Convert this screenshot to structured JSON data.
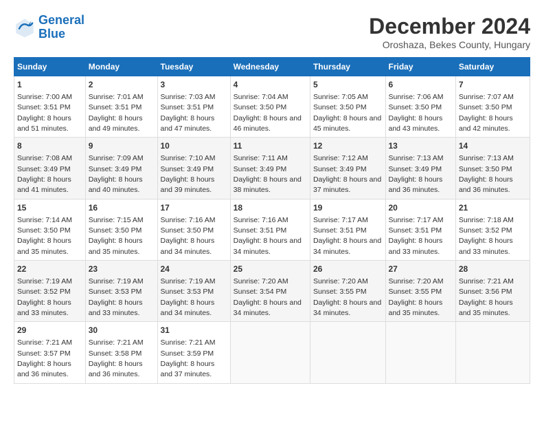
{
  "header": {
    "logo_line1": "General",
    "logo_line2": "Blue",
    "month_title": "December 2024",
    "subtitle": "Oroshaza, Bekes County, Hungary"
  },
  "weekdays": [
    "Sunday",
    "Monday",
    "Tuesday",
    "Wednesday",
    "Thursday",
    "Friday",
    "Saturday"
  ],
  "weeks": [
    [
      {
        "day": "1",
        "sunrise": "7:00 AM",
        "sunset": "3:51 PM",
        "daylight": "8 hours and 51 minutes."
      },
      {
        "day": "2",
        "sunrise": "7:01 AM",
        "sunset": "3:51 PM",
        "daylight": "8 hours and 49 minutes."
      },
      {
        "day": "3",
        "sunrise": "7:03 AM",
        "sunset": "3:51 PM",
        "daylight": "8 hours and 47 minutes."
      },
      {
        "day": "4",
        "sunrise": "7:04 AM",
        "sunset": "3:50 PM",
        "daylight": "8 hours and 46 minutes."
      },
      {
        "day": "5",
        "sunrise": "7:05 AM",
        "sunset": "3:50 PM",
        "daylight": "8 hours and 45 minutes."
      },
      {
        "day": "6",
        "sunrise": "7:06 AM",
        "sunset": "3:50 PM",
        "daylight": "8 hours and 43 minutes."
      },
      {
        "day": "7",
        "sunrise": "7:07 AM",
        "sunset": "3:50 PM",
        "daylight": "8 hours and 42 minutes."
      }
    ],
    [
      {
        "day": "8",
        "sunrise": "7:08 AM",
        "sunset": "3:49 PM",
        "daylight": "8 hours and 41 minutes."
      },
      {
        "day": "9",
        "sunrise": "7:09 AM",
        "sunset": "3:49 PM",
        "daylight": "8 hours and 40 minutes."
      },
      {
        "day": "10",
        "sunrise": "7:10 AM",
        "sunset": "3:49 PM",
        "daylight": "8 hours and 39 minutes."
      },
      {
        "day": "11",
        "sunrise": "7:11 AM",
        "sunset": "3:49 PM",
        "daylight": "8 hours and 38 minutes."
      },
      {
        "day": "12",
        "sunrise": "7:12 AM",
        "sunset": "3:49 PM",
        "daylight": "8 hours and 37 minutes."
      },
      {
        "day": "13",
        "sunrise": "7:13 AM",
        "sunset": "3:49 PM",
        "daylight": "8 hours and 36 minutes."
      },
      {
        "day": "14",
        "sunrise": "7:13 AM",
        "sunset": "3:50 PM",
        "daylight": "8 hours and 36 minutes."
      }
    ],
    [
      {
        "day": "15",
        "sunrise": "7:14 AM",
        "sunset": "3:50 PM",
        "daylight": "8 hours and 35 minutes."
      },
      {
        "day": "16",
        "sunrise": "7:15 AM",
        "sunset": "3:50 PM",
        "daylight": "8 hours and 35 minutes."
      },
      {
        "day": "17",
        "sunrise": "7:16 AM",
        "sunset": "3:50 PM",
        "daylight": "8 hours and 34 minutes."
      },
      {
        "day": "18",
        "sunrise": "7:16 AM",
        "sunset": "3:51 PM",
        "daylight": "8 hours and 34 minutes."
      },
      {
        "day": "19",
        "sunrise": "7:17 AM",
        "sunset": "3:51 PM",
        "daylight": "8 hours and 34 minutes."
      },
      {
        "day": "20",
        "sunrise": "7:17 AM",
        "sunset": "3:51 PM",
        "daylight": "8 hours and 33 minutes."
      },
      {
        "day": "21",
        "sunrise": "7:18 AM",
        "sunset": "3:52 PM",
        "daylight": "8 hours and 33 minutes."
      }
    ],
    [
      {
        "day": "22",
        "sunrise": "7:19 AM",
        "sunset": "3:52 PM",
        "daylight": "8 hours and 33 minutes."
      },
      {
        "day": "23",
        "sunrise": "7:19 AM",
        "sunset": "3:53 PM",
        "daylight": "8 hours and 33 minutes."
      },
      {
        "day": "24",
        "sunrise": "7:19 AM",
        "sunset": "3:53 PM",
        "daylight": "8 hours and 34 minutes."
      },
      {
        "day": "25",
        "sunrise": "7:20 AM",
        "sunset": "3:54 PM",
        "daylight": "8 hours and 34 minutes."
      },
      {
        "day": "26",
        "sunrise": "7:20 AM",
        "sunset": "3:55 PM",
        "daylight": "8 hours and 34 minutes."
      },
      {
        "day": "27",
        "sunrise": "7:20 AM",
        "sunset": "3:55 PM",
        "daylight": "8 hours and 35 minutes."
      },
      {
        "day": "28",
        "sunrise": "7:21 AM",
        "sunset": "3:56 PM",
        "daylight": "8 hours and 35 minutes."
      }
    ],
    [
      {
        "day": "29",
        "sunrise": "7:21 AM",
        "sunset": "3:57 PM",
        "daylight": "8 hours and 36 minutes."
      },
      {
        "day": "30",
        "sunrise": "7:21 AM",
        "sunset": "3:58 PM",
        "daylight": "8 hours and 36 minutes."
      },
      {
        "day": "31",
        "sunrise": "7:21 AM",
        "sunset": "3:59 PM",
        "daylight": "8 hours and 37 minutes."
      },
      null,
      null,
      null,
      null
    ]
  ]
}
